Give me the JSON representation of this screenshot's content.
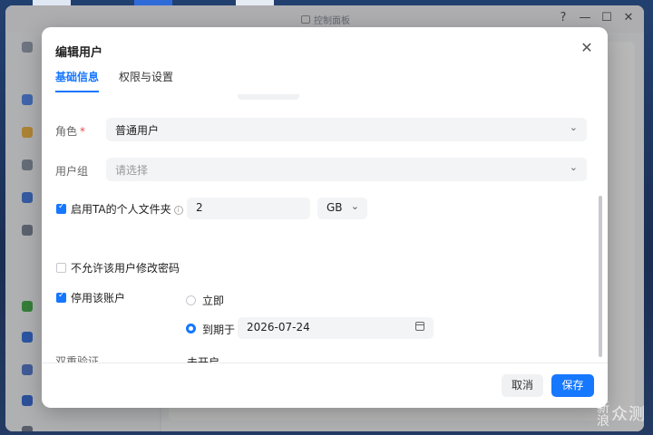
{
  "background_window": {
    "title": "控制面板",
    "controls": [
      "?",
      "—",
      "☐",
      "✕"
    ]
  },
  "dialog": {
    "title": "编辑用户",
    "tabs": [
      {
        "label": "基础信息",
        "active": true
      },
      {
        "label": "权限与设置",
        "active": false
      }
    ],
    "role": {
      "label": "角色",
      "required_mark": "*",
      "value": "普通用户"
    },
    "user_group": {
      "label": "用户组",
      "placeholder": "请选择"
    },
    "personal_folder": {
      "label": "启用TA的个人文件夹",
      "checked": true,
      "quota": "2",
      "unit": "GB"
    },
    "no_password_change": {
      "label": "不允许该用户修改密码",
      "checked": false
    },
    "disable_account": {
      "label": "停用该账户",
      "checked": true,
      "option_immediate": "立即",
      "option_expire": "到期于",
      "expire_date": "2026-07-24",
      "selected": "expire"
    },
    "two_factor": {
      "label": "双重验证",
      "value": "未开启"
    },
    "buttons": {
      "cancel": "取消",
      "save": "保存"
    }
  },
  "colors": {
    "accent": "#1677ff",
    "required": "#e34d4d"
  },
  "watermark": {
    "text1": "新浪",
    "text2": "众测"
  }
}
